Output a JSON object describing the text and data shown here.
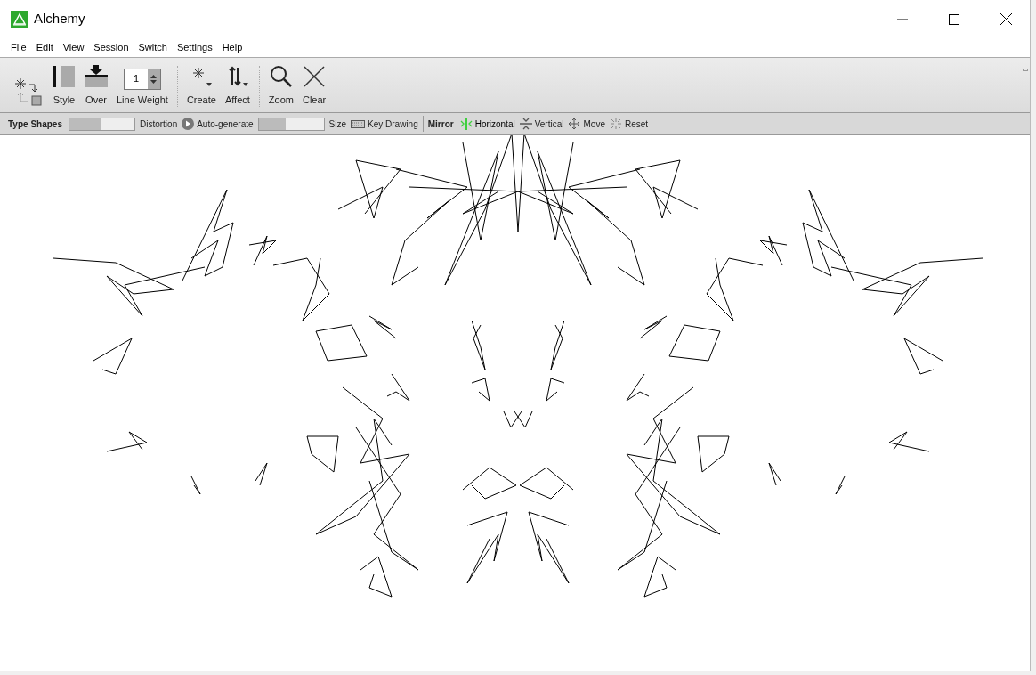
{
  "window": {
    "title": "Alchemy"
  },
  "menu": [
    "File",
    "Edit",
    "View",
    "Session",
    "Switch",
    "Settings",
    "Help"
  ],
  "toolbar": [
    {
      "kind": "swap"
    },
    {
      "kind": "style",
      "label": "Style"
    },
    {
      "kind": "over",
      "label": "Over"
    },
    {
      "kind": "spinner",
      "label": "Line Weight",
      "value": "1"
    },
    {
      "kind": "separator"
    },
    {
      "kind": "create",
      "label": "Create"
    },
    {
      "kind": "affect",
      "label": "Affect"
    },
    {
      "kind": "separator"
    },
    {
      "kind": "zoom",
      "label": "Zoom"
    },
    {
      "kind": "clear",
      "label": "Clear"
    }
  ],
  "options": [
    {
      "kind": "heading",
      "label": "Type Shapes"
    },
    {
      "kind": "slider",
      "level": 0.5
    },
    {
      "kind": "text",
      "label": "Distortion"
    },
    {
      "kind": "play",
      "label": "Auto-generate"
    },
    {
      "kind": "slider",
      "level": 0.42
    },
    {
      "kind": "text",
      "label": "Size"
    },
    {
      "kind": "keyboard",
      "label": "Key Drawing"
    },
    {
      "kind": "separator"
    },
    {
      "kind": "heading",
      "label": "Mirror"
    },
    {
      "kind": "horizontal",
      "label": "Horizontal",
      "selected": true
    },
    {
      "kind": "vertical",
      "label": "Vertical",
      "selected": false
    },
    {
      "kind": "move",
      "label": "Move"
    },
    {
      "kind": "reset",
      "label": "Reset"
    }
  ]
}
